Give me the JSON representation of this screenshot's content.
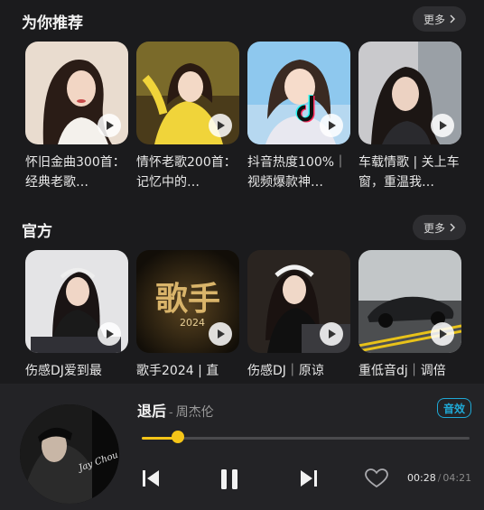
{
  "recommend": {
    "title": "为你推荐",
    "more_label": "更多",
    "items": [
      {
        "title": "怀旧金曲300首：经典老歌…"
      },
      {
        "title": "情怀老歌200首：记忆中的…"
      },
      {
        "title": "抖音热度100%｜视频爆款神…"
      },
      {
        "title": "车载情歌 | 关上车窗，重温我…"
      }
    ]
  },
  "official": {
    "title": "官方",
    "more_label": "更多",
    "items": [
      {
        "title": "伤感DJ爱到最"
      },
      {
        "title": "歌手2024 | 直"
      },
      {
        "title": "伤感DJ｜原谅"
      },
      {
        "title": "重低音dj｜调倍"
      }
    ],
    "cover_texts": {
      "singer_big": "歌手",
      "singer_year": "2024"
    }
  },
  "player": {
    "song": "退后",
    "separator": "-",
    "artist": "周杰伦",
    "effect_label": "音效",
    "progress": 0.11,
    "current_time": "00:28",
    "time_separator": "/",
    "total_time": "04:21",
    "disc_text": "Jay Chou"
  },
  "colors": {
    "accent": "#f5c518",
    "effect": "#1fa9d6",
    "background": "#1b1b1d"
  },
  "icons": [
    "chevron-right-icon",
    "play-icon",
    "previous-icon",
    "pause-icon",
    "next-icon",
    "heart-icon"
  ]
}
